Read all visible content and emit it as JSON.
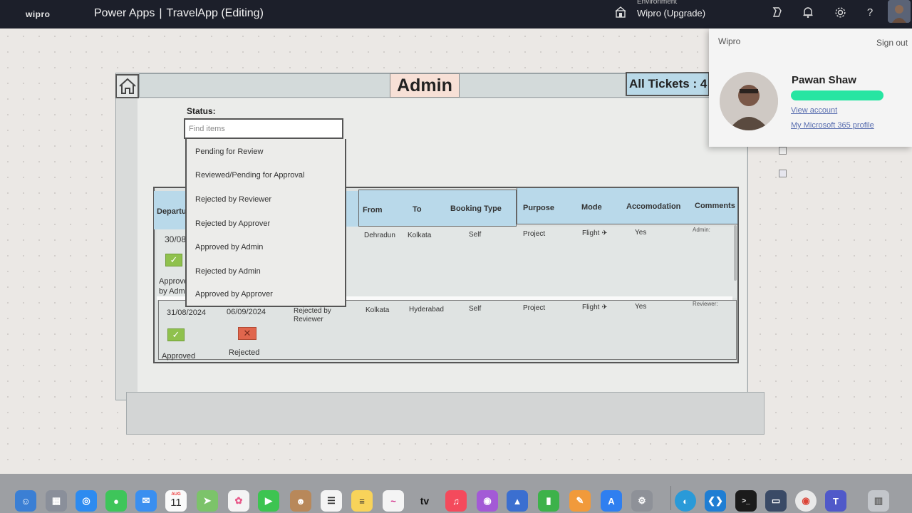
{
  "topbar": {
    "logo": "wipro",
    "app_name": "Power Apps",
    "separator": "|",
    "app_title": "TravelApp (Editing)",
    "environment_label": "Environment",
    "environment_value": "Wipro (Upgrade)",
    "icons": [
      "environment-icon",
      "copilot-icon",
      "bell-icon",
      "gear-icon",
      "help-icon",
      "profile-avatar"
    ],
    "help_glyph": "?"
  },
  "app": {
    "header_title": "Admin",
    "tickets_label": "All Tickets : 4",
    "status_label": "Status:",
    "search_placeholder": "Find items",
    "status_options": [
      "Pending for Review",
      "Reviewed/Pending for Approval",
      "Rejected by Reviewer",
      "Rejected by Approver",
      "Approved by Admin",
      "Rejected by Admin",
      "Approved by Approver"
    ],
    "columns": {
      "departure": "Departu",
      "from": "From",
      "to": "To",
      "booking_type": "Booking Type",
      "purpose": "Purpose",
      "mode": "Mode",
      "accomodation": "Accomodation",
      "comments": "Comments"
    },
    "rows": [
      {
        "departure": "30/08",
        "from": "Dehradun",
        "to": "Kolkata",
        "booking_type": "Self",
        "purpose": "Project",
        "mode": "Flight ✈",
        "accomodation": "Yes",
        "comment": "Admin:",
        "status1_a": "Approve",
        "status1_b": "by Adm"
      },
      {
        "departure": "31/08/2024",
        "return": "06/09/2024",
        "status_text_a": "Rejected by",
        "status_text_b": "Reviewer",
        "from": "Kolkata",
        "to": "Hyderabad",
        "booking_type": "Self",
        "purpose": "Project",
        "mode": "Flight ✈",
        "accomodation": "Yes",
        "comment": "Reviewer:",
        "status1": "Approved",
        "status2": "Rejected"
      }
    ]
  },
  "account": {
    "org": "Wipro",
    "sign_out": "Sign out",
    "name": "Pawan Shaw",
    "view_account": "View account",
    "m365_profile": "My Microsoft 365 profile"
  },
  "dock": {
    "calendar_month": "AUG",
    "calendar_day": "11",
    "tv_label": "tv",
    "apps": [
      "finder",
      "launchpad",
      "safari",
      "messages",
      "mail",
      "calendar",
      "maps",
      "photos",
      "facetime",
      "contacts",
      "reminders",
      "notes",
      "freeform",
      "tv",
      "music",
      "podcasts",
      "keynote",
      "numbers",
      "pages",
      "app-store",
      "system-settings",
      "edge",
      "vscode",
      "terminal",
      "ssh-client",
      "chrome",
      "teams",
      "trash"
    ]
  },
  "colors": {
    "topbar": "#1c1f2a",
    "header_blue": "#b9d9ea",
    "admin_bg": "#f7e0d6",
    "check_green": "#8fc14d",
    "cross_red": "#e0664d",
    "email_highlight": "#27e5a2",
    "link": "#5a6fb0"
  }
}
